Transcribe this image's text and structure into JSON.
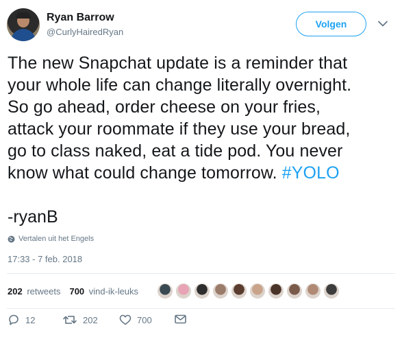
{
  "user": {
    "name": "Ryan Barrow",
    "handle": "@CurlyHairedRyan"
  },
  "follow_button": {
    "label": "Volgen"
  },
  "tweet": {
    "lines": [
      "The new Snapchat update is a reminder that",
      "your whole life can change literally overnight.",
      "So go ahead, order cheese on your fries,",
      "attack your roommate if they use your bread,",
      "go to class naked, eat a tide pod. You never"
    ],
    "last_line_text": "know what could change tomorrow. ",
    "hashtag": "#YOLO",
    "signature": "-ryanB"
  },
  "translate": {
    "label": "Vertalen uit het Engels"
  },
  "timestamp": "17:33 - 7 feb. 2018",
  "stats": {
    "retweets_count": "202",
    "retweets_label": "retweets",
    "likes_count": "700",
    "likes_label": "vind-ik-leuks"
  },
  "likers": [
    {
      "color": "#3a4a52"
    },
    {
      "color": "#e8a3b5"
    },
    {
      "color": "#2e2e2e"
    },
    {
      "color": "#9b7b6a"
    },
    {
      "color": "#5a3d2e"
    },
    {
      "color": "#c9a48a"
    },
    {
      "color": "#4a3328"
    },
    {
      "color": "#7a5a4a"
    },
    {
      "color": "#b08a74"
    },
    {
      "color": "#3d3d3d"
    }
  ],
  "actions": {
    "reply_count": "12",
    "retweet_count": "202",
    "like_count": "700"
  },
  "colors": {
    "accent": "#1da1f2",
    "text": "#14171a",
    "muted": "#657786",
    "divider": "#e6ecf0"
  },
  "icons": {
    "caret": "chevron-down-icon",
    "globe": "globe-icon",
    "reply": "reply-icon",
    "retweet": "retweet-icon",
    "like": "heart-icon",
    "dm": "envelope-icon"
  }
}
